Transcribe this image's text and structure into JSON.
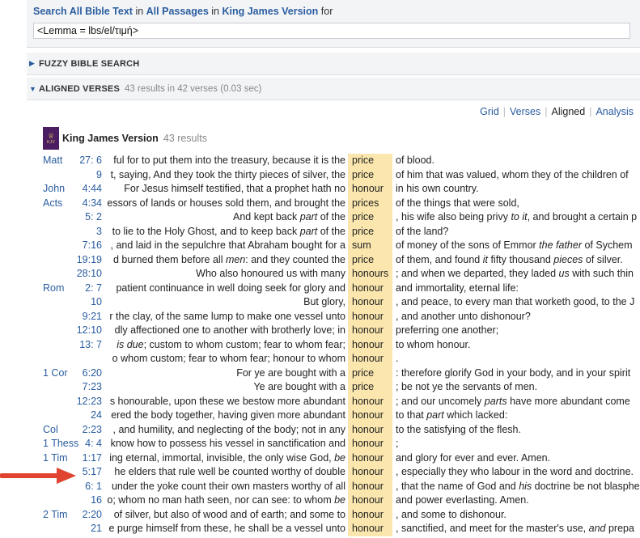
{
  "search": {
    "part1": "Search All Bible Text",
    "part2": " in ",
    "part3": "All Passages",
    "part4": " in ",
    "part5": "King James Version",
    "part6": " for",
    "query": "<Lemma = lbs/el/τιμή>"
  },
  "fuzzy": {
    "label": "FUZZY BIBLE SEARCH"
  },
  "aligned": {
    "label": "ALIGNED VERSES",
    "meta": "43 results in 42 verses (0.03 sec)"
  },
  "views": [
    "Grid",
    "Verses",
    "Aligned",
    "Analysis"
  ],
  "version": {
    "name": "King James Version",
    "count": "43 results",
    "icon_text": "KJV"
  },
  "rows": [
    {
      "book": "Matt",
      "ref": "27: 6",
      "left": "ful for to put them into the treasury, because it is the",
      "hit": "price",
      "right": "of blood."
    },
    {
      "book": "",
      "ref": "9",
      "left": "t, saying, And they took the thirty pieces of silver, the",
      "hit": "price",
      "right": "of him that was valued, whom they of the children of"
    },
    {
      "book": "John",
      "ref": "4:44",
      "left": "For Jesus himself testified, that a prophet hath no",
      "hit": "honour",
      "right": "in his own country."
    },
    {
      "book": "Acts",
      "ref": "4:34",
      "left": "essors of lands or houses sold them, and brought the",
      "hit": "prices",
      "right": "of the things that were sold,"
    },
    {
      "book": "",
      "ref": "5: 2",
      "left": "And kept back <i>part</i> of the",
      "hit": "price",
      "right": ", his wife also being privy <i>to it</i>, and brought a certain p"
    },
    {
      "book": "",
      "ref": "3",
      "left": "to lie to the Holy Ghost, and to keep back <i>part</i> of the",
      "hit": "price",
      "right": "of the land?"
    },
    {
      "book": "",
      "ref": "7:16",
      "left": ", and laid in the sepulchre that Abraham bought for a",
      "hit": "sum",
      "right": "of money of the sons of Emmor <i>the father</i> of Sychem"
    },
    {
      "book": "",
      "ref": "19:19",
      "left": "d burned them before all <i>men</i>: and they counted the",
      "hit": "price",
      "right": "of them, and found <i>it</i> fifty thousand <i>pieces</i> of silver."
    },
    {
      "book": "",
      "ref": "28:10",
      "left": "Who also honoured us with many",
      "hit": "honours",
      "right": "; and when we departed, they laded <i>us</i> with such thin"
    },
    {
      "book": "Rom",
      "ref": "2: 7",
      "left": "patient continuance in well doing seek for glory and",
      "hit": "honour",
      "right": "and immortality, eternal life:"
    },
    {
      "book": "",
      "ref": "10",
      "left": "But glory,",
      "hit": "honour",
      "right": ", and peace, to every man that worketh good, to the J"
    },
    {
      "book": "",
      "ref": "9:21",
      "left": "r the clay, of the same lump to make one vessel unto",
      "hit": "honour",
      "right": ", and another unto dishonour?"
    },
    {
      "book": "",
      "ref": "12:10",
      "left": "dly affectioned one to another with brotherly love; in",
      "hit": "honour",
      "right": "preferring one another;"
    },
    {
      "book": "",
      "ref": "13: 7",
      "left": "<i>is due</i>; custom to whom custom; fear to whom fear;",
      "hit": "honour",
      "right": "to whom honour."
    },
    {
      "book": "",
      "ref": "",
      "left": "o whom custom; fear to whom fear; honour to whom",
      "hit": "honour",
      "right": "."
    },
    {
      "book": "1 Cor",
      "ref": "6:20",
      "left": "For ye are bought with a",
      "hit": "price",
      "right": ": therefore glorify God in your body, and in your spirit"
    },
    {
      "book": "",
      "ref": "7:23",
      "left": "Ye are bought with a",
      "hit": "price",
      "right": "; be not ye the servants of men."
    },
    {
      "book": "",
      "ref": "12:23",
      "left": "s honourable, upon these we bestow more abundant",
      "hit": "honour",
      "right": "; and our uncomely <i>parts</i> have more abundant come"
    },
    {
      "book": "",
      "ref": "24",
      "left": "ered the body together, having given more abundant",
      "hit": "honour",
      "right": "to that <i>part</i> which lacked:"
    },
    {
      "book": "Col",
      "ref": "2:23",
      "left": ", and humility, and neglecting of the body; not in any",
      "hit": "honour",
      "right": "to the satisfying of the flesh."
    },
    {
      "book": "1 Thess",
      "ref": "4: 4",
      "left": "know how to possess his vessel in sanctification and",
      "hit": "honour",
      "right": ";"
    },
    {
      "book": "1 Tim",
      "ref": "1:17",
      "left": "ing eternal, immortal, invisible, the only wise God, <i>be</i>",
      "hit": "honour",
      "right": "and glory for ever and ever. Amen."
    },
    {
      "book": "",
      "ref": "5:17",
      "left": "he elders that rule well be counted worthy of double",
      "hit": "honour",
      "right": ", especially they who labour in the word and doctrine."
    },
    {
      "book": "",
      "ref": "6: 1",
      "left": "under the yoke count their own masters worthy of all",
      "hit": "honour",
      "right": ", that the name of God and <i>his</i> doctrine be not blasphe"
    },
    {
      "book": "",
      "ref": "16",
      "left": "o; whom no man hath seen, nor can see: to whom <i>be</i>",
      "hit": "honour",
      "right": "and power everlasting. Amen."
    },
    {
      "book": "2 Tim",
      "ref": "2:20",
      "left": "of silver, but also of wood and of earth; and some to",
      "hit": "honour",
      "right": ", and some to dishonour."
    },
    {
      "book": "",
      "ref": "21",
      "left": "e purge himself from these, he shall be a vessel unto",
      "hit": "honour",
      "right": ", sanctified, and meet for the master's use, <i>and</i> prepa"
    }
  ],
  "colors": {
    "link": "#2a5d9f",
    "highlight": "#fbe7ae",
    "arrow": "#e0432f",
    "panel": "#f3f4f6"
  }
}
